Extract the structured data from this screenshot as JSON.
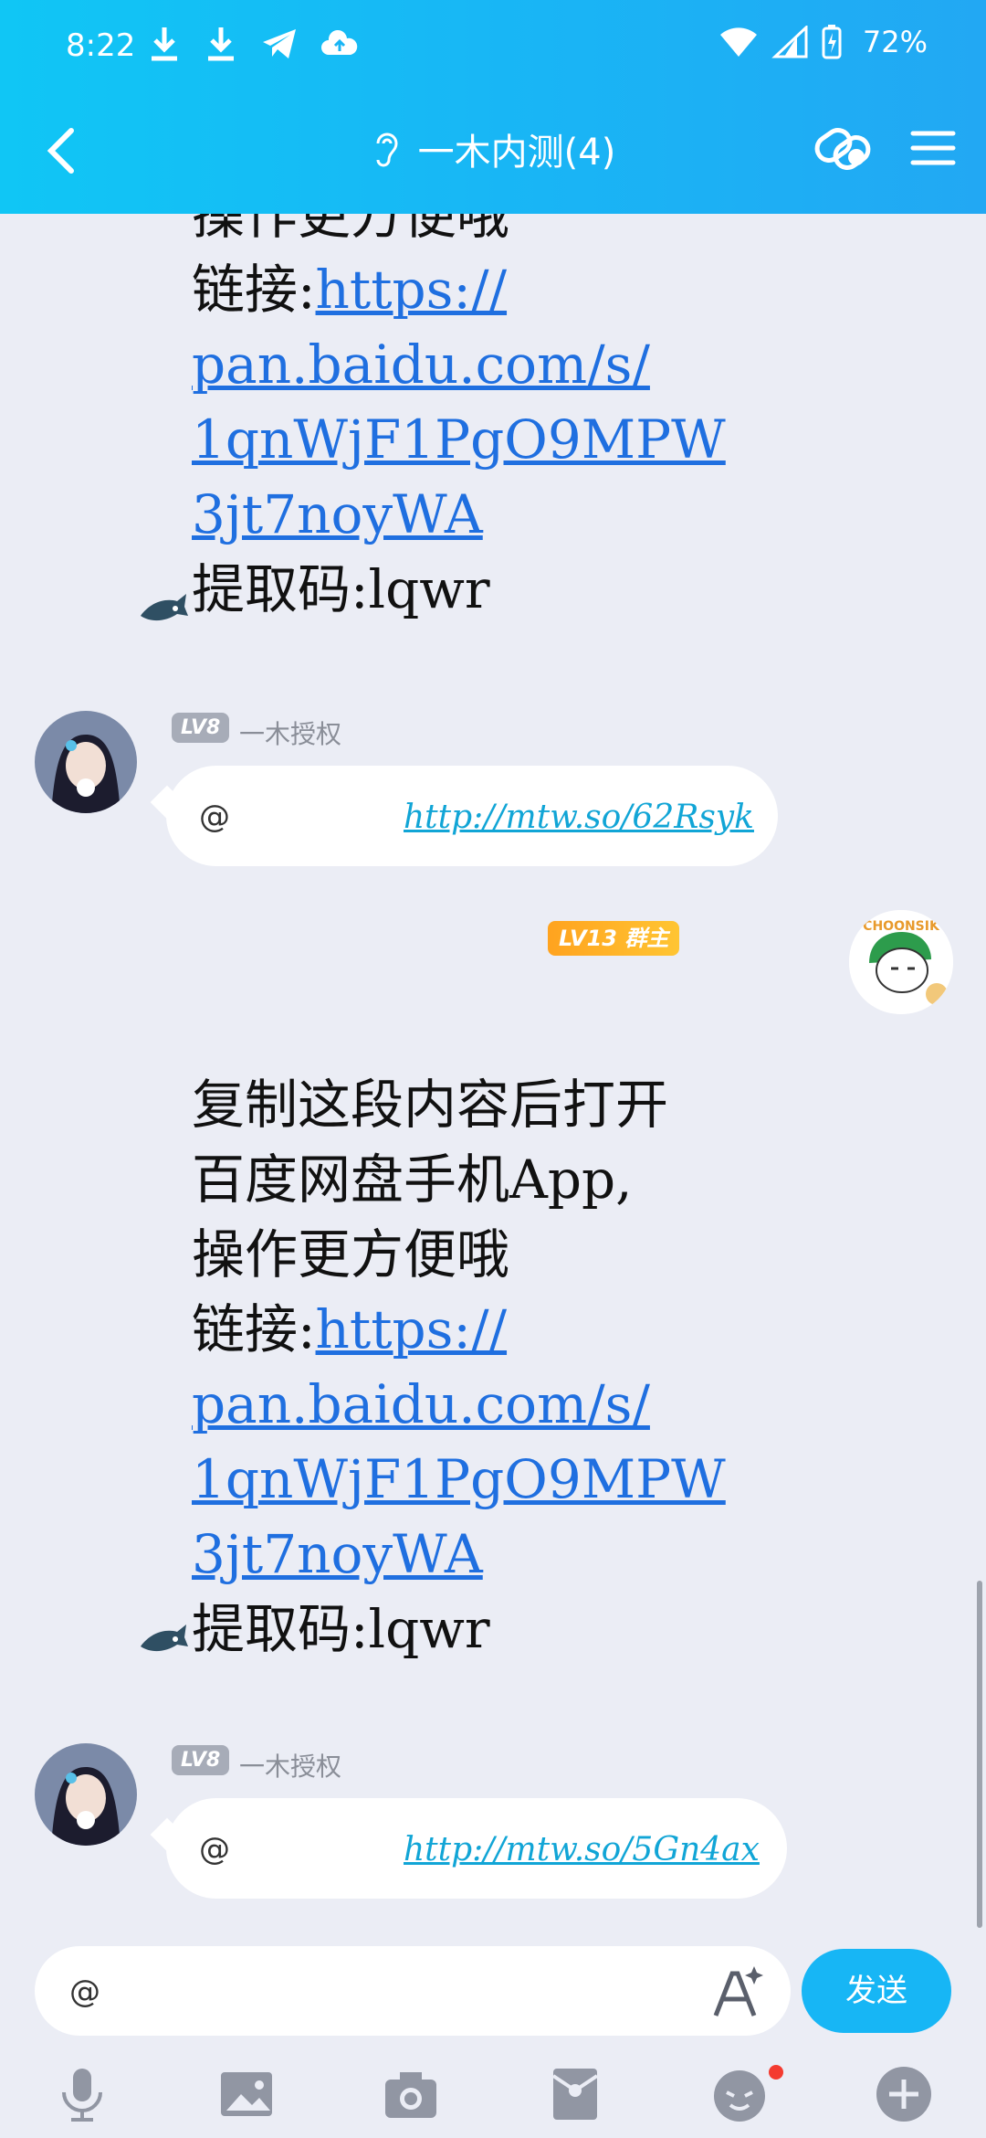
{
  "status_bar": {
    "time": "8:22",
    "battery": "72%"
  },
  "header": {
    "title": "一木内测(4)"
  },
  "messages": [
    {
      "type": "text",
      "lines": [
        "操作更方便哦"
      ],
      "link_prefix": "链接:",
      "link": "https://pan.baidu.com/s/1qnWjF1PgO9MPW3jt7noyWA",
      "link_lines": [
        "https://",
        "pan.baidu.com/s/",
        "1qnWjF1PgO9MPW",
        "3jt7noyWA"
      ],
      "code": "提取码:lqwr"
    },
    {
      "type": "link",
      "level": "LV8",
      "sender": "一木授权",
      "at": "@",
      "link": "http://mtw.so/62Rsyk"
    },
    {
      "type": "text",
      "level": "LV13",
      "role": "群主",
      "avatar_text": "CHOONSIK",
      "lines": [
        "复制这段内容后打开",
        "百度网盘手机App,",
        "操作更方便哦"
      ],
      "link_prefix": "链接:",
      "link": "https://pan.baidu.com/s/1qnWjF1PgO9MPW3jt7noyWA",
      "link_lines": [
        "https://",
        "pan.baidu.com/s/",
        "1qnWjF1PgO9MPW",
        "3jt7noyWA"
      ],
      "code": "提取码:lqwr"
    },
    {
      "type": "link",
      "level": "LV8",
      "sender": "一木授权",
      "at": "@",
      "link": "http://mtw.so/5Gn4ax"
    }
  ],
  "input": {
    "value": "@",
    "send_label": "发送"
  },
  "colors": {
    "header": "#19b5f5",
    "send": "#17b6f5",
    "link": "#11a5d6",
    "owner_badge": "#ffa31f"
  },
  "icons": [
    "download-icon",
    "download-icon",
    "telegram-icon",
    "cloud-upload-icon",
    "wifi-icon",
    "signal-icon",
    "battery-icon",
    "back-icon",
    "ear-icon",
    "link-icon",
    "menu-icon",
    "font-icon",
    "microphone-icon",
    "image-icon",
    "camera-icon",
    "red-packet-icon",
    "emoji-icon",
    "plus-icon"
  ]
}
